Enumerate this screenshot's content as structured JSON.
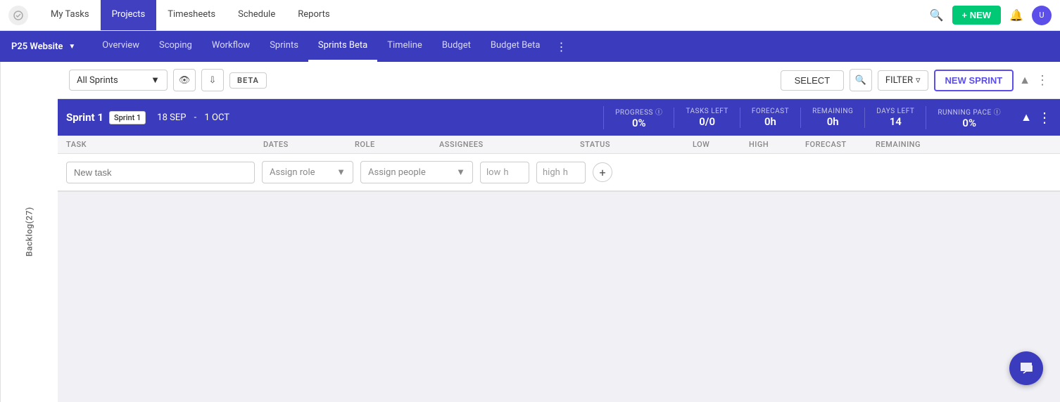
{
  "top_nav": {
    "tabs": [
      {
        "id": "my-tasks",
        "label": "My Tasks",
        "active": false
      },
      {
        "id": "projects",
        "label": "Projects",
        "active": true
      },
      {
        "id": "timesheets",
        "label": "Timesheets",
        "active": false
      },
      {
        "id": "schedule",
        "label": "Schedule",
        "active": false
      },
      {
        "id": "reports",
        "label": "Reports",
        "active": false
      }
    ],
    "new_button": "+ NEW",
    "avatar_initials": "U"
  },
  "project_nav": {
    "project_name": "P25 Website",
    "tabs": [
      {
        "id": "overview",
        "label": "Overview",
        "active": false
      },
      {
        "id": "scoping",
        "label": "Scoping",
        "active": false
      },
      {
        "id": "workflow",
        "label": "Workflow",
        "active": false
      },
      {
        "id": "sprints",
        "label": "Sprints",
        "active": false
      },
      {
        "id": "sprints-beta",
        "label": "Sprints Beta",
        "active": true
      },
      {
        "id": "timeline",
        "label": "Timeline",
        "active": false
      },
      {
        "id": "budget",
        "label": "Budget",
        "active": false
      },
      {
        "id": "budget-beta",
        "label": "Budget Beta",
        "active": false
      }
    ]
  },
  "toolbar": {
    "all_sprints_label": "All Sprints",
    "beta_label": "BETA",
    "select_label": "SELECT",
    "filter_label": "FILTER",
    "new_sprint_label": "NEW SPRINT"
  },
  "sidebar": {
    "label": "Backlog(27)"
  },
  "sprint": {
    "title": "Sprint 1",
    "tooltip": "Sprint 1",
    "date_start": "18 SEP",
    "date_sep": "-",
    "date_end": "1 OCT",
    "stats": [
      {
        "id": "progress",
        "label": "PROGRESS ⓘ",
        "value": "0%"
      },
      {
        "id": "tasks-left",
        "label": "TASKS LEFT",
        "value": "0/0"
      },
      {
        "id": "forecast",
        "label": "FORECAST",
        "value": "0h"
      },
      {
        "id": "remaining",
        "label": "REMAINING",
        "value": "0h"
      },
      {
        "id": "days-left",
        "label": "DAYS LEFT",
        "value": "14"
      },
      {
        "id": "running-pace",
        "label": "RUNNING PACE ⓘ",
        "value": "0%"
      }
    ]
  },
  "columns": {
    "headers": [
      "TASK",
      "DATES",
      "ROLE",
      "ASSIGNEES",
      "STATUS",
      "LOW",
      "HIGH",
      "FORECAST",
      "REMAINING"
    ]
  },
  "new_task_row": {
    "task_placeholder": "New task",
    "role_placeholder": "Assign role",
    "people_placeholder": "Assign people",
    "low_placeholder": "low",
    "high_placeholder": "high",
    "low_suffix": "h",
    "high_suffix": "h"
  }
}
